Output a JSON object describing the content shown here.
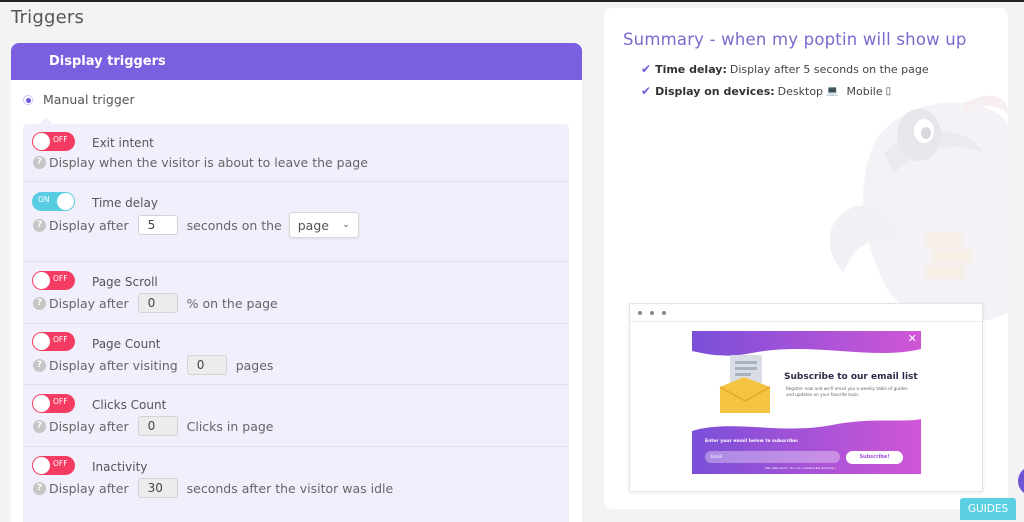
{
  "page": {
    "title": "Triggers"
  },
  "display_triggers": {
    "header": "Display triggers",
    "manual_trigger_label": "Manual trigger",
    "triggers": [
      {
        "name": "Exit intent",
        "toggle": "OFF",
        "text_before": "Display when the visitor is about to leave the page"
      },
      {
        "name": "Time delay",
        "toggle": "ON",
        "text_before": "Display after",
        "value": "5",
        "text_after": "seconds on the",
        "select_value": "page"
      },
      {
        "name": "Page Scroll",
        "toggle": "OFF",
        "text_before": "Display after",
        "value": "0",
        "text_after": "% on the page"
      },
      {
        "name": "Page Count",
        "toggle": "OFF",
        "text_before": "Display after visiting",
        "value": "0",
        "text_after": "pages"
      },
      {
        "name": "Clicks Count",
        "toggle": "OFF",
        "text_before": "Display after",
        "value": "0",
        "text_after": "Clicks in page"
      },
      {
        "name": "Inactivity",
        "toggle": "OFF",
        "text_before": "Display after",
        "value": "30",
        "text_after": "seconds after the visitor was idle"
      }
    ]
  },
  "summary": {
    "title": "Summary - when my poptin will show up",
    "time_delay_label": "Time delay:",
    "time_delay_value": "Display after 5 seconds on the page",
    "devices_label": "Display on devices:",
    "device_desktop": "Desktop",
    "device_mobile": "Mobile",
    "icons": [
      "check-icon",
      "laptop-icon",
      "mobile-icon"
    ]
  },
  "popup_preview": {
    "title": "Subscribe to our email list",
    "subtitle": "Register now and we'll email you a weekly table of guides and updates on your favorite topic.",
    "input_label": "Enter your email below to subscribe:",
    "email_placeholder": "Email",
    "button_label": "Subscribe!",
    "note": "(We hate spam. You can unsubscribe anytime.)"
  },
  "guides_label": "GUIDES",
  "colors": {
    "accent": "#7a5fde",
    "toggle_off": "#f43c63",
    "toggle_on": "#58cde2",
    "guides": "#5ad0e2"
  }
}
